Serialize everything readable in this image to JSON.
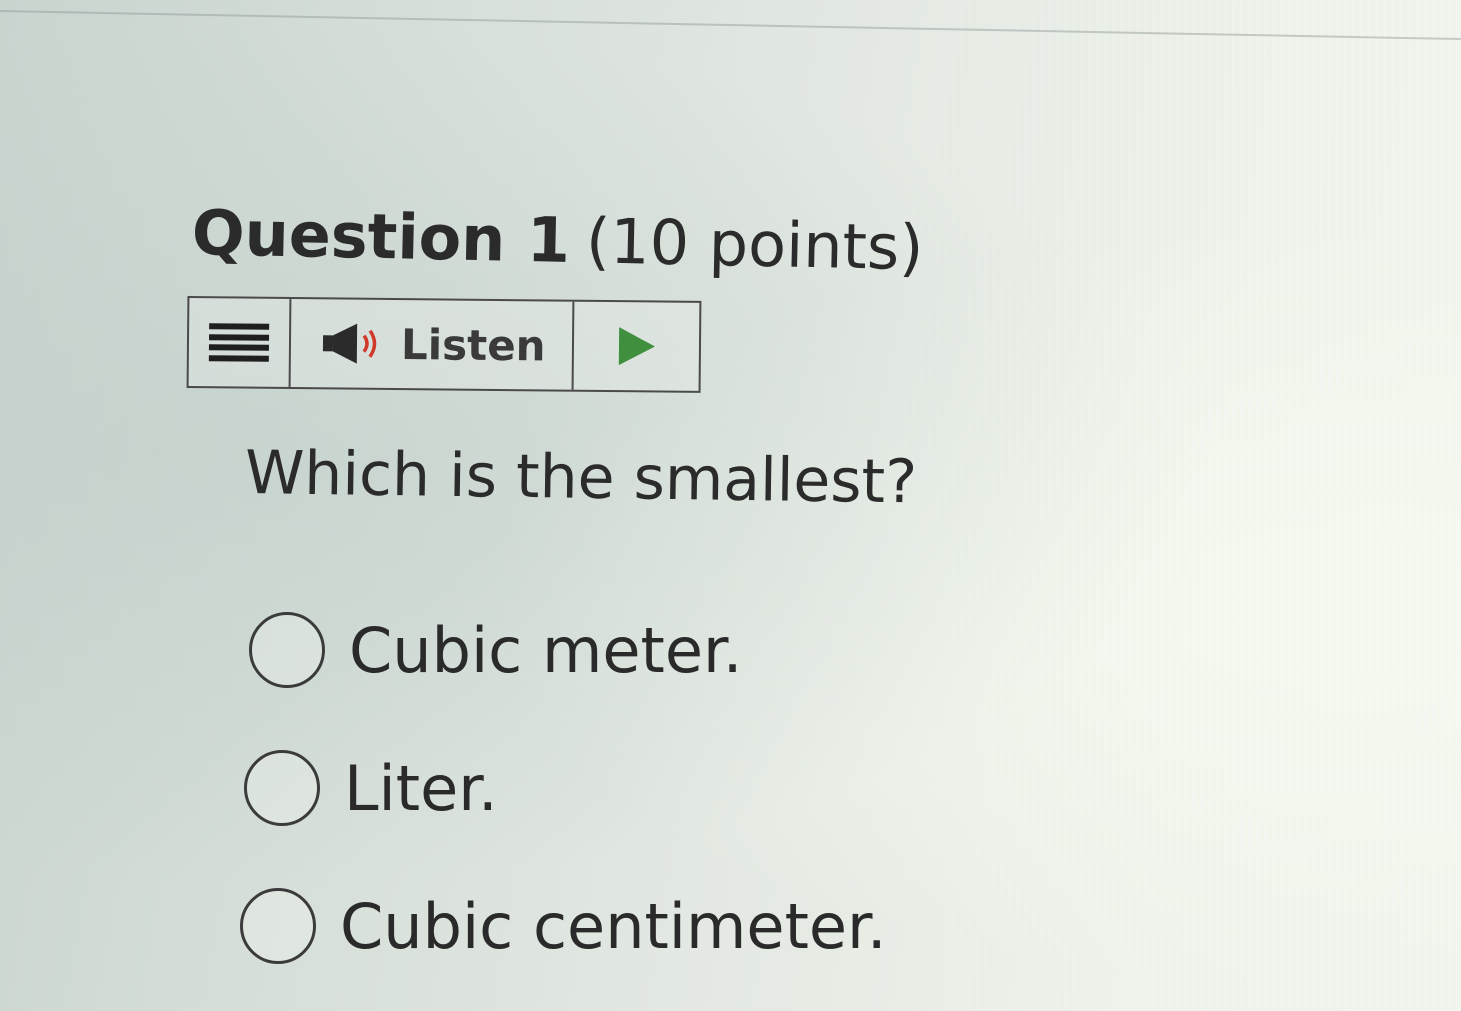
{
  "question": {
    "label": "Question 1",
    "points": "(10 points)",
    "prompt": "Which is the smallest?"
  },
  "toolbar": {
    "menu_icon": "menu-lines-icon",
    "speaker_icon": "speaker-icon",
    "listen_label": "Listen",
    "play_icon": "play-icon",
    "play_color": "#3f8f3f"
  },
  "options": [
    {
      "label": "Cubic meter.",
      "selected": false
    },
    {
      "label": "Liter.",
      "selected": false
    },
    {
      "label": "Cubic centimeter.",
      "selected": false
    }
  ]
}
